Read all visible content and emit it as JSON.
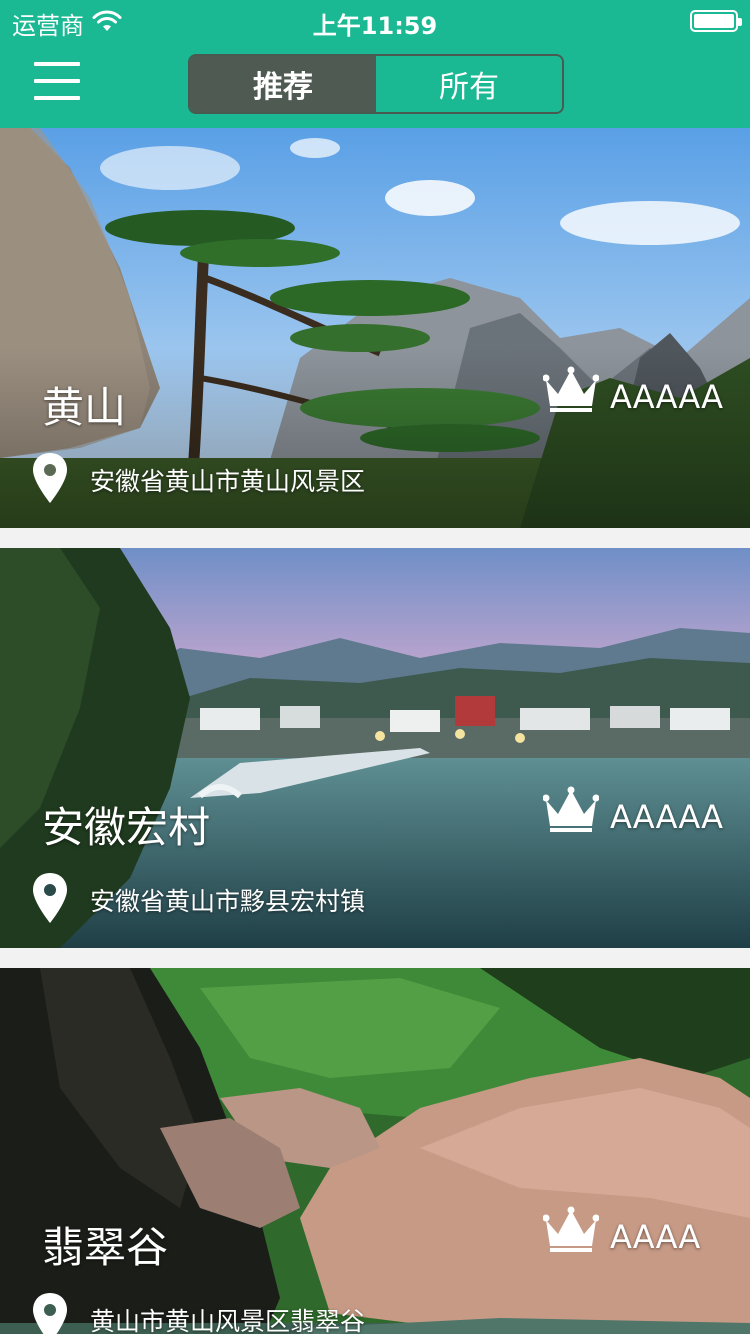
{
  "status_bar": {
    "carrier": "运营商",
    "time": "上午11:59"
  },
  "nav": {
    "tabs": [
      {
        "label": "推荐",
        "active": true
      },
      {
        "label": "所有",
        "active": false
      }
    ]
  },
  "colors": {
    "brand": "#1bb894",
    "segment_active": "#4f5a52"
  },
  "scenic_spots": [
    {
      "name": "黄山",
      "rating": "AAAAA",
      "address": "安徽省黄山市黄山风景区"
    },
    {
      "name": "安徽宏村",
      "rating": "AAAAA",
      "address": "安徽省黄山市黟县宏村镇"
    },
    {
      "name": "翡翠谷",
      "rating": "AAAA",
      "address": "黄山市黄山风景区翡翠谷"
    }
  ]
}
